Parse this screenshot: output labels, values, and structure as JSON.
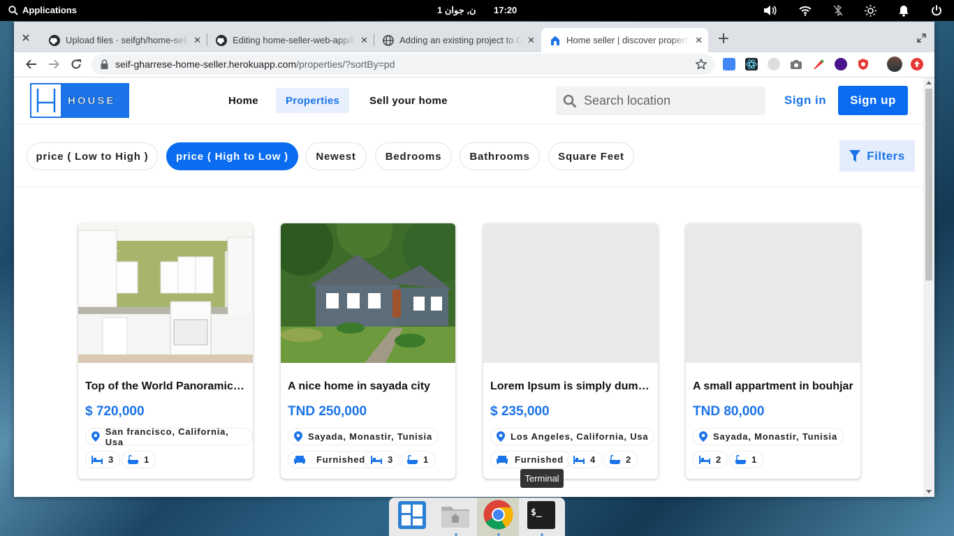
{
  "system": {
    "apps_label": "Applications",
    "date": "ن, جوان  1",
    "time": "17:20"
  },
  "tabs": [
    {
      "title": "Upload files · seifgh/home-seller-web-app",
      "icon": "github-icon"
    },
    {
      "title": "Editing home-seller-web-app/README.md",
      "icon": "github-icon"
    },
    {
      "title": "Adding an existing project to GitHub",
      "icon": "globe-icon"
    },
    {
      "title": "Home seller | discover properties",
      "icon": "house-icon",
      "active": true
    }
  ],
  "address": {
    "host": "seif-gharrese-home-seller.herokuapp.com",
    "path": "/properties/?sortBy=pd"
  },
  "site": {
    "logo_text": "HOUSE",
    "nav": [
      "Home",
      "Properties",
      "Sell your home"
    ],
    "active_nav": "Properties",
    "search_placeholder": "Search location",
    "signin": "Sign in",
    "signup": "Sign up",
    "sort_options": [
      "price ( Low to High )",
      "price ( High to Low )",
      "Newest",
      "Bedrooms",
      "Bathrooms",
      "Square Feet"
    ],
    "active_sort": "price ( High to Low )",
    "filters_label": "Filters"
  },
  "listings": [
    {
      "title": "Top of the World Panoramic Views",
      "price": "$ 720,000",
      "location": "San francisco, California, Usa",
      "furnished": "",
      "beds": "3",
      "baths": "1",
      "image": "kitchen"
    },
    {
      "title": "A nice home in sayada city",
      "price": "TND 250,000",
      "location": "Sayada, Monastir, Tunisia",
      "furnished": "Furnished",
      "beds": "3",
      "baths": "1",
      "image": "house"
    },
    {
      "title": "Lorem Ipsum is simply dummy text",
      "price": "$ 235,000",
      "location": "Los Angeles, California, Usa",
      "furnished": "Furnished",
      "beds": "4",
      "baths": "2",
      "image": "placeholder"
    },
    {
      "title": "A small appartment in bouhjar",
      "price": "TND 80,000",
      "location": "Sayada, Monastir, Tunisia",
      "furnished": "",
      "beds": "2",
      "baths": "1",
      "image": "placeholder"
    }
  ],
  "dock": {
    "tooltip": "Terminal",
    "apps": [
      "workspaces-icon",
      "files-icon",
      "chrome-icon",
      "terminal-icon"
    ]
  },
  "colors": {
    "accent": "#0a6cf0",
    "link": "#1a73e8"
  }
}
